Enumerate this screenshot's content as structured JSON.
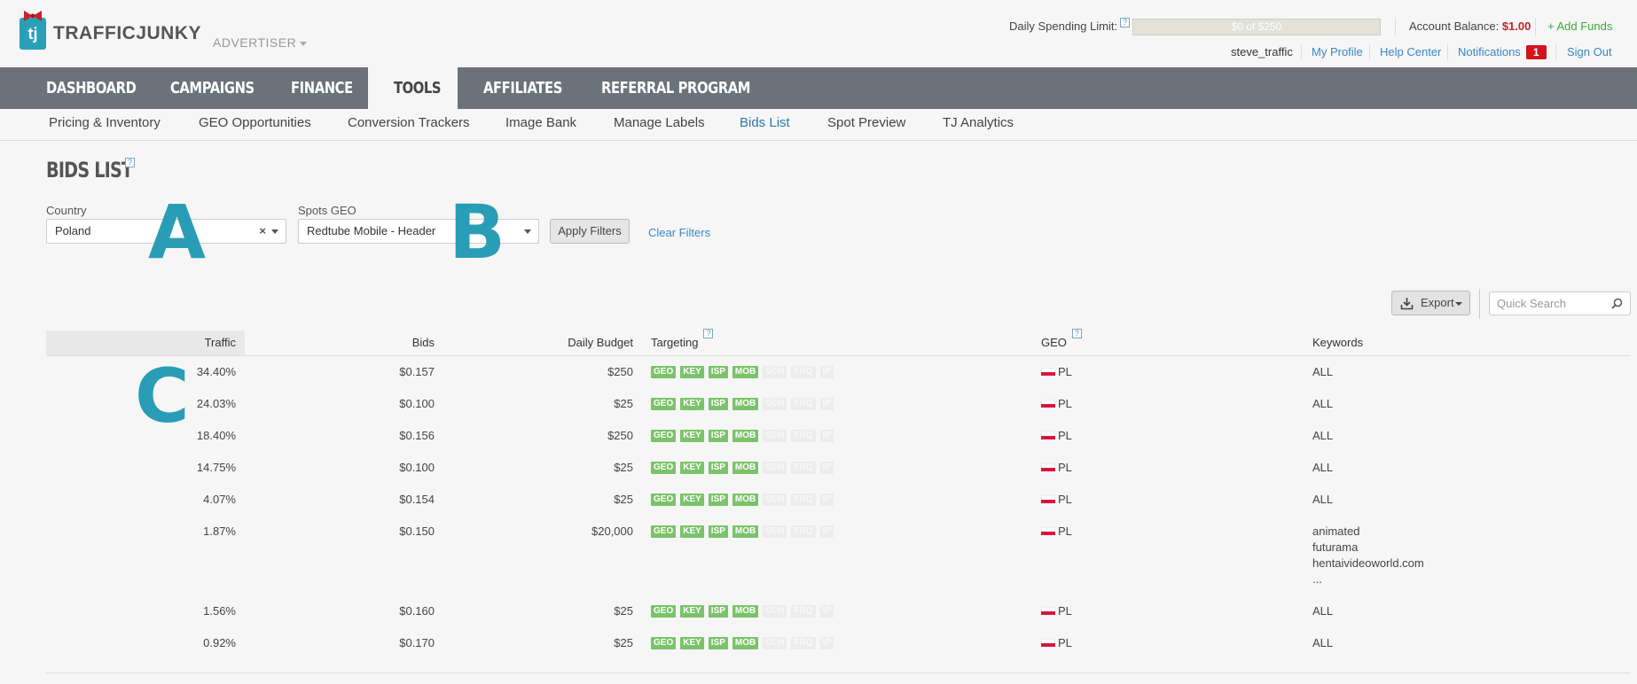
{
  "brand": {
    "logo_text": "TRAFFICJUNKY",
    "logo_glyph": "tj",
    "role": "ADVERTISER"
  },
  "account": {
    "daily_limit_label": "Daily Spending Limit:",
    "daily_limit_value": "$0 of $250",
    "balance_label": "Account Balance:",
    "balance_amount": "$1.00",
    "add_funds": "+ Add Funds",
    "username": "steve_traffic",
    "my_profile": "My Profile",
    "help_center": "Help Center",
    "notifications": "Notifications",
    "notifications_count": "1",
    "sign_out": "Sign Out"
  },
  "nav": {
    "items": [
      "DASHBOARD",
      "CAMPAIGNS",
      "FINANCE",
      "TOOLS",
      "AFFILIATES",
      "REFERRAL PROGRAM"
    ],
    "active": "TOOLS"
  },
  "subnav": {
    "items": [
      "Pricing & Inventory",
      "GEO Opportunities",
      "Conversion Trackers",
      "Image Bank",
      "Manage Labels",
      "Bids List",
      "Spot Preview",
      "TJ Analytics"
    ],
    "active": "Bids List"
  },
  "page": {
    "title": "BIDS LIST"
  },
  "filters": {
    "country_label": "Country",
    "country_value": "Poland",
    "spots_label": "Spots GEO",
    "spots_value": "Redtube Mobile - Header",
    "apply": "Apply Filters",
    "clear": "Clear Filters"
  },
  "overlay_letters": {
    "a": "A",
    "b": "B",
    "c": "C"
  },
  "toolbar": {
    "export": "Export",
    "search_placeholder": "Quick Search"
  },
  "table": {
    "headers": {
      "traffic": "Traffic",
      "bids": "Bids",
      "budget": "Daily Budget",
      "targeting": "Targeting",
      "geo": "GEO",
      "keywords": "Keywords"
    },
    "targeting_tags": [
      {
        "label": "GEO",
        "active": true
      },
      {
        "label": "KEY",
        "active": true
      },
      {
        "label": "ISP",
        "active": true
      },
      {
        "label": "MOB",
        "active": true
      },
      {
        "label": "SCH",
        "active": false
      },
      {
        "label": "FRQ",
        "active": false
      },
      {
        "label": "IP",
        "active": false
      }
    ],
    "rows": [
      {
        "traffic": "34.40%",
        "bid": "$0.157",
        "budget": "$250",
        "geo": "PL",
        "keywords": [
          "ALL"
        ]
      },
      {
        "traffic": "24.03%",
        "bid": "$0.100",
        "budget": "$25",
        "geo": "PL",
        "keywords": [
          "ALL"
        ]
      },
      {
        "traffic": "18.40%",
        "bid": "$0.156",
        "budget": "$250",
        "geo": "PL",
        "keywords": [
          "ALL"
        ]
      },
      {
        "traffic": "14.75%",
        "bid": "$0.100",
        "budget": "$25",
        "geo": "PL",
        "keywords": [
          "ALL"
        ]
      },
      {
        "traffic": "4.07%",
        "bid": "$0.154",
        "budget": "$25",
        "geo": "PL",
        "keywords": [
          "ALL"
        ]
      },
      {
        "traffic": "1.87%",
        "bid": "$0.150",
        "budget": "$20,000",
        "geo": "PL",
        "keywords": [
          "animated",
          "futurama",
          "hentaivideoworld.com",
          "..."
        ]
      },
      {
        "traffic": "1.56%",
        "bid": "$0.160",
        "budget": "$25",
        "geo": "PL",
        "keywords": [
          "ALL"
        ]
      },
      {
        "traffic": "0.92%",
        "bid": "$0.170",
        "budget": "$25",
        "geo": "PL",
        "keywords": [
          "ALL"
        ]
      }
    ]
  },
  "colors": {
    "accent": "#2a9db6",
    "nav_bg": "#6b7279",
    "tag_on": "#7ac36a",
    "link": "#3b86c6",
    "danger": "#d4141c",
    "funds": "#3aaa35"
  }
}
